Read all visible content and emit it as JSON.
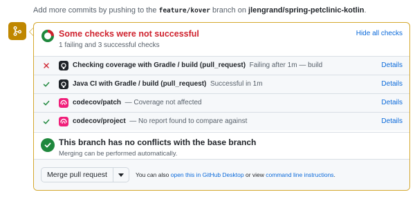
{
  "header": {
    "prefix": "Add more commits by pushing to the",
    "branch": "feature/kover",
    "middle": "branch on",
    "repo": "jlengrand/spring-petclinic-kotlin",
    "suffix": "."
  },
  "summary": {
    "title": "Some checks were not successful",
    "subtitle": "1 failing and 3 successful checks",
    "hide_link": "Hide all checks",
    "failing": 1,
    "successful": 3
  },
  "checks": [
    {
      "status": "failing",
      "icon": "github-icon",
      "name": "Checking coverage with Gradle / build (pull_request)",
      "desc": "Failing after 1m — build",
      "details": "Details"
    },
    {
      "status": "success",
      "icon": "github-icon",
      "name": "Java CI with Gradle / build (pull_request)",
      "desc": "Successful in 1m",
      "details": "Details"
    },
    {
      "status": "success",
      "icon": "codecov-icon",
      "name": "codecov/patch",
      "desc": "— Coverage not affected",
      "details": "Details"
    },
    {
      "status": "success",
      "icon": "codecov-icon",
      "name": "codecov/project",
      "desc": "— No report found to compare against",
      "details": "Details"
    }
  ],
  "conflict": {
    "title": "This branch has no conflicts with the base branch",
    "subtitle": "Merging can be performed automatically."
  },
  "merge": {
    "button_label": "Merge pull request",
    "hint_prefix": "You can also",
    "desktop_link": "open this in GitHub Desktop",
    "hint_middle": "or view",
    "cli_link": "command line instructions",
    "hint_suffix": "."
  },
  "colors": {
    "fail": "#cf222e",
    "success": "#1f883d",
    "warning_border": "#d4a72c",
    "merge_badge": "#bf8700",
    "link": "#0969da"
  }
}
